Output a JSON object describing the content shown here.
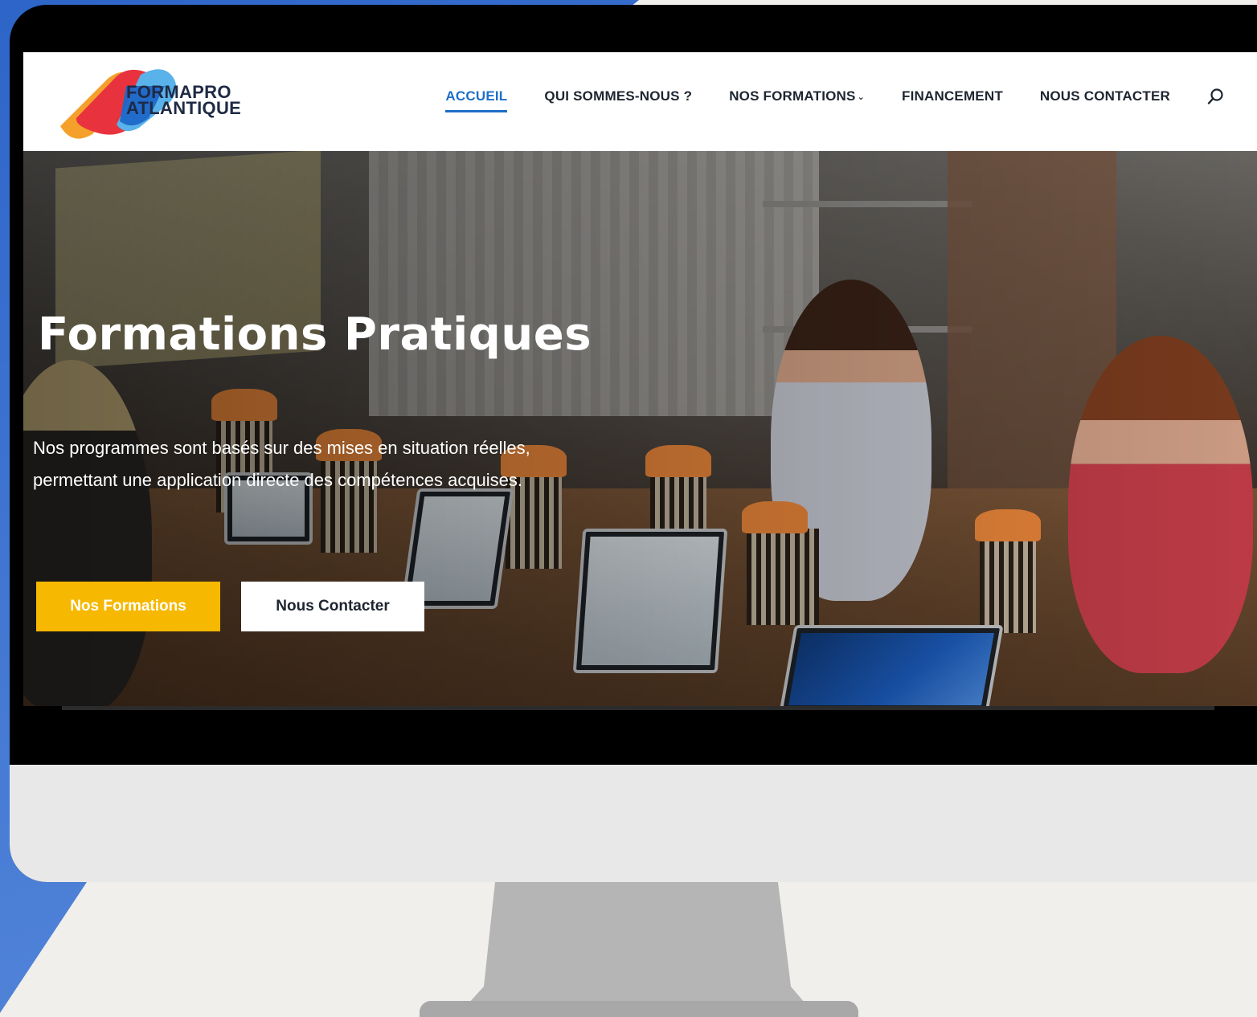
{
  "brand": {
    "line1": "FORMAPRO",
    "line2": "ATLANTIQUE",
    "colors": {
      "red": "#e8333f",
      "orange": "#f5a02a",
      "blue": "#1f67c8",
      "lightblue": "#59b2e9"
    }
  },
  "nav": {
    "items": [
      {
        "label": "ACCUEIL",
        "active": true
      },
      {
        "label": "QUI SOMMES-NOUS ?",
        "active": false
      },
      {
        "label": "NOS FORMATIONS",
        "active": false,
        "has_dropdown": true
      },
      {
        "label": "FINANCEMENT",
        "active": false
      },
      {
        "label": "NOUS CONTACTER",
        "active": false
      }
    ],
    "search_icon": "search-icon",
    "active_color": "#1e6fc6"
  },
  "hero": {
    "title": "Formations Pratiques",
    "subtitle_line1": "Nos programmes sont basés sur des mises en situation réelles,",
    "subtitle_line2": "permettant une application directe des compétences acquises.",
    "primary_button": "Nos Formations",
    "secondary_button": "Nous Contacter",
    "primary_color": "#f6b800"
  }
}
